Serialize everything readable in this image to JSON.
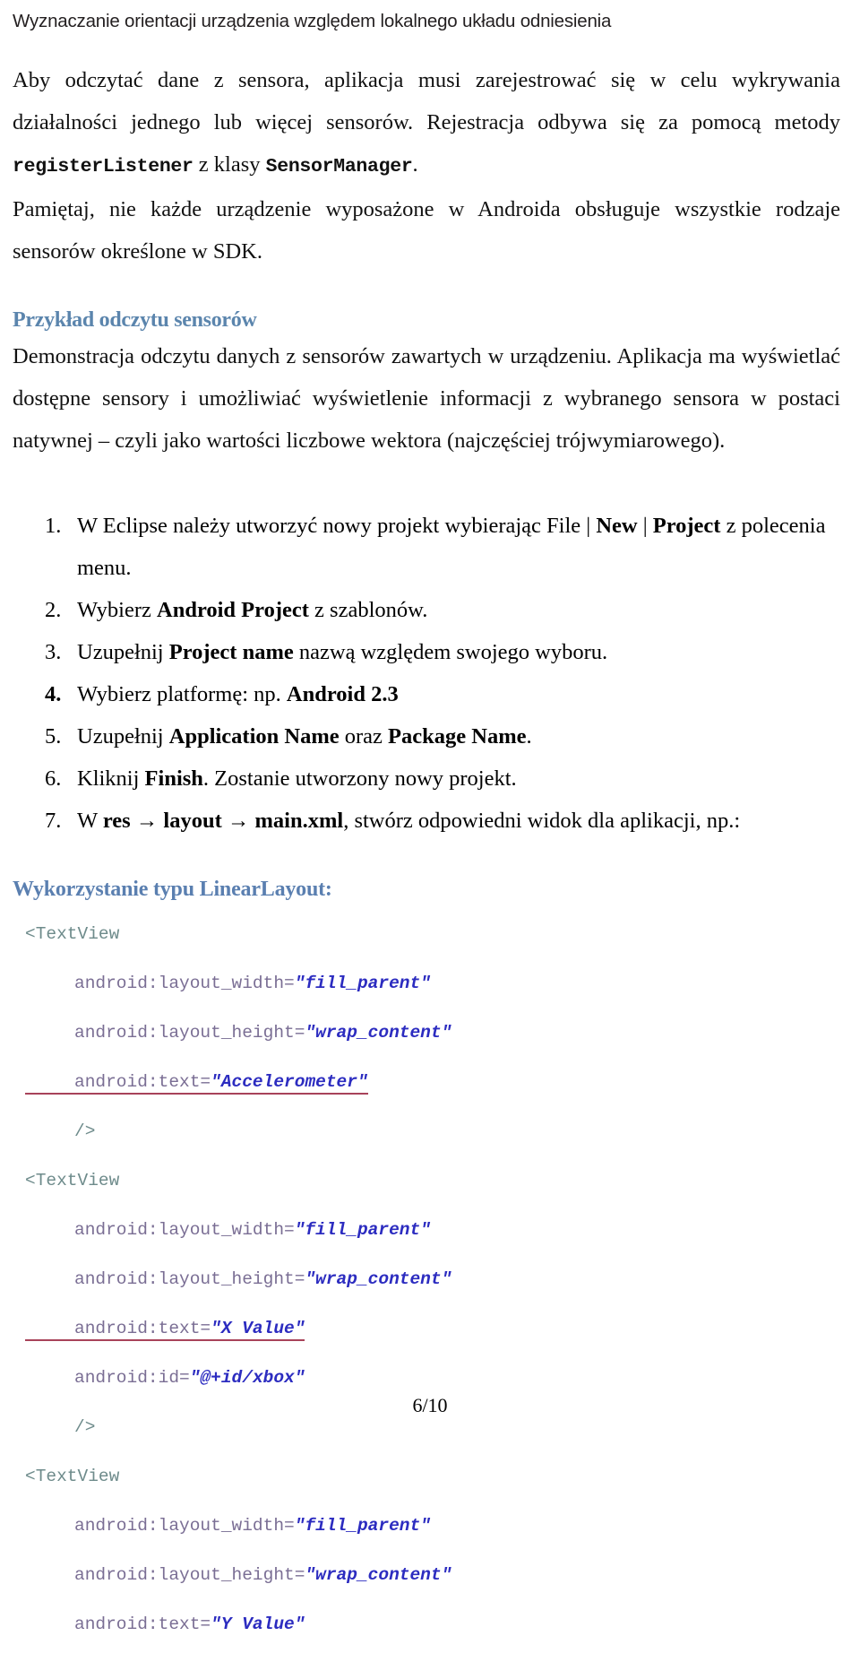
{
  "header": {
    "running_title": "Wyznaczanie orientacji urządzenia względem lokalnego układu odniesienia"
  },
  "intro": {
    "para1_part1": "Aby odczytać dane z sensora, aplikacja musi zarejestrować się w celu wykrywania działalności jednego lub więcej sensorów. Rejestracja odbywa się za pomocą metody ",
    "para1_code1": "registerListener",
    "para1_part2": " z klasy ",
    "para1_code2": "SensorManager",
    "para1_part3": ".",
    "para2": "Pamiętaj, nie każde urządzenie wyposażone w Androida obsługuje wszystkie rodzaje sensorów określone w SDK."
  },
  "section_sensors": {
    "heading": "Przykład odczytu sensorów",
    "description": "Demonstracja odczytu danych z sensorów zawartych w urządzeniu. Aplikacja ma wyświetlać dostępne sensory i umożliwiać wyświetlenie informacji z wybranego sensora w postaci natywnej – czyli jako wartości liczbowe wektora (najczęściej trójwymiarowego)."
  },
  "steps": [
    {
      "number": "1.",
      "number_bold": false,
      "parts": [
        {
          "text": "W Eclipse należy utworzyć nowy projekt wybierając File | ",
          "bold": false
        },
        {
          "text": "New",
          "bold": true
        },
        {
          "text": " | ",
          "bold": false
        },
        {
          "text": "Project",
          "bold": true
        },
        {
          "text": "  z polecenia menu.",
          "bold": false
        }
      ]
    },
    {
      "number": "2.",
      "number_bold": false,
      "parts": [
        {
          "text": "Wybierz ",
          "bold": false
        },
        {
          "text": "Android Project",
          "bold": true
        },
        {
          "text": " z szablonów.",
          "bold": false
        }
      ]
    },
    {
      "number": "3.",
      "number_bold": false,
      "parts": [
        {
          "text": "Uzupełnij  ",
          "bold": false
        },
        {
          "text": "Project name",
          "bold": true
        },
        {
          "text": "  nazwą względem swojego wyboru.",
          "bold": false
        }
      ]
    },
    {
      "number": "4.",
      "number_bold": true,
      "parts": [
        {
          "text": "Wybierz platformę: np. ",
          "bold": false
        },
        {
          "text": "Android 2.3",
          "bold": true
        }
      ]
    },
    {
      "number": "5.",
      "number_bold": false,
      "parts": [
        {
          "text": "Uzupełnij ",
          "bold": false
        },
        {
          "text": "Application Name",
          "bold": true
        },
        {
          "text": " oraz ",
          "bold": false
        },
        {
          "text": "Package Name",
          "bold": true
        },
        {
          "text": ".",
          "bold": false
        }
      ]
    },
    {
      "number": "6.",
      "number_bold": false,
      "parts": [
        {
          "text": "Kliknij ",
          "bold": false
        },
        {
          "text": "Finish",
          "bold": true
        },
        {
          "text": ". Zostanie utworzony nowy projekt.",
          "bold": false
        }
      ]
    },
    {
      "number": "7.",
      "number_bold": false,
      "parts": [
        {
          "text": "W ",
          "bold": false
        },
        {
          "text": "res → layout → main.xml",
          "bold": true
        },
        {
          "text": ", stwórz odpowiedni widok dla aplikacji, np.:",
          "bold": false
        }
      ]
    }
  ],
  "section_linearlayout": {
    "heading": "Wykorzystanie typu LinearLayout:"
  },
  "code": {
    "lines": [
      {
        "indent": 0,
        "tokens": [
          {
            "cls": "tag",
            "t": "<TextView"
          }
        ]
      },
      {
        "indent": 1,
        "tokens": [
          {
            "cls": "attr",
            "t": "android:layout_width="
          },
          {
            "cls": "val",
            "t": "\"fill_parent\""
          }
        ]
      },
      {
        "indent": 1,
        "tokens": [
          {
            "cls": "attr",
            "t": "android:layout_height="
          },
          {
            "cls": "val",
            "t": "\"wrap_content\""
          }
        ]
      },
      {
        "indent": 1,
        "spell": true,
        "tokens": [
          {
            "cls": "attr",
            "t": "android:text="
          },
          {
            "cls": "val",
            "t": "\"Accelerometer\""
          }
        ]
      },
      {
        "indent": 1,
        "tokens": [
          {
            "cls": "tag",
            "t": "/>"
          }
        ]
      },
      {
        "indent": 0,
        "tokens": [
          {
            "cls": "tag",
            "t": "<TextView"
          }
        ]
      },
      {
        "indent": 1,
        "tokens": [
          {
            "cls": "attr",
            "t": "android:layout_width="
          },
          {
            "cls": "val",
            "t": "\"fill_parent\""
          }
        ]
      },
      {
        "indent": 1,
        "tokens": [
          {
            "cls": "attr",
            "t": "android:layout_height="
          },
          {
            "cls": "val",
            "t": "\"wrap_content\""
          }
        ]
      },
      {
        "indent": 1,
        "spell": true,
        "tokens": [
          {
            "cls": "attr",
            "t": "android:text="
          },
          {
            "cls": "val",
            "t": "\"X Value\""
          }
        ]
      },
      {
        "indent": 1,
        "tokens": [
          {
            "cls": "attr",
            "t": "android:id="
          },
          {
            "cls": "val",
            "t": "\"@+id/xbox\""
          }
        ]
      },
      {
        "indent": 1,
        "tokens": [
          {
            "cls": "tag",
            "t": "/>"
          }
        ]
      },
      {
        "indent": 0,
        "tokens": [
          {
            "cls": "tag",
            "t": "<TextView"
          }
        ]
      },
      {
        "indent": 1,
        "tokens": [
          {
            "cls": "attr",
            "t": "android:layout_width="
          },
          {
            "cls": "val",
            "t": "\"fill_parent\""
          }
        ]
      },
      {
        "indent": 1,
        "tokens": [
          {
            "cls": "attr",
            "t": "android:layout_height="
          },
          {
            "cls": "val",
            "t": "\"wrap_content\""
          }
        ]
      },
      {
        "indent": 1,
        "tokens": [
          {
            "cls": "attr",
            "t": "android:text="
          },
          {
            "cls": "val",
            "t": "\"Y Value\""
          }
        ]
      }
    ]
  },
  "footer": {
    "page_label": "6/10"
  },
  "colors": {
    "heading_blue": "#5b85ad",
    "code_tag": "#6e8b8b",
    "code_attr": "#7a6e94",
    "code_value": "#2c2cc0",
    "spellcheck_underline": "#a8435a",
    "body_text": "#111111"
  }
}
